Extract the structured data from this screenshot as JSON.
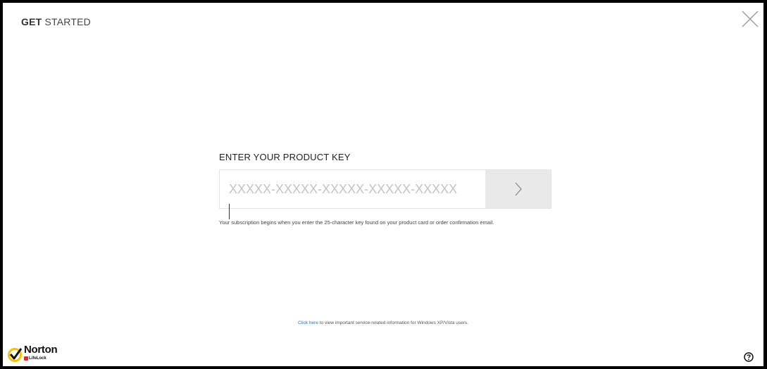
{
  "window": {
    "title_bold": "GET",
    "title_rest": "STARTED"
  },
  "product_key": {
    "label": "ENTER YOUR PRODUCT KEY",
    "placeholder": "XXXXX-XXXXX-XXXXX-XXXXX-XXXXX",
    "value": "",
    "submit_icon": "chevron-right-icon",
    "help_text": "Your subscription begins when you enter the 25-character key found on your product card or order confirmation email."
  },
  "footer": {
    "link_text": "Click here",
    "note_text": " to view important service-related information for Windows XP/Vista users."
  },
  "logo": {
    "name": "Norton",
    "sub": "LifeLock"
  },
  "icons": {
    "close": "close-icon",
    "help": "help-icon"
  },
  "colors": {
    "accent_yellow": "#f5c400",
    "link_blue": "#1a73c8",
    "lifelock_red": "#e32b2b",
    "submit_bg": "#e9e9e9"
  }
}
